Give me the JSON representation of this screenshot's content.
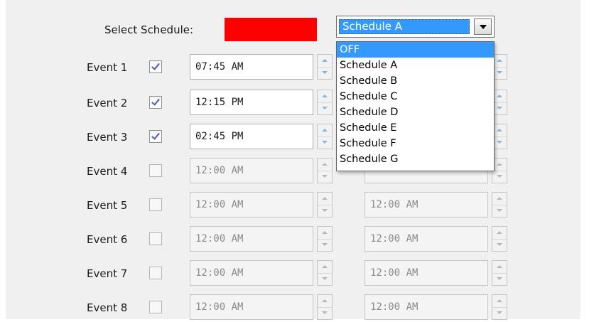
{
  "schedule": {
    "label": "Select Schedule:",
    "color": "#ff0000",
    "selected": "Schedule A",
    "options": [
      "OFF",
      "Schedule A",
      "Schedule B",
      "Schedule C",
      "Schedule D",
      "Schedule E",
      "Schedule F",
      "Schedule G"
    ],
    "highlighted_option": "OFF"
  },
  "events": [
    {
      "label": "Event 1",
      "checked": true,
      "start": "07:45 AM",
      "end": ""
    },
    {
      "label": "Event 2",
      "checked": true,
      "start": "12:15 PM",
      "end": ""
    },
    {
      "label": "Event 3",
      "checked": true,
      "start": "02:45 PM",
      "end": ""
    },
    {
      "label": "Event 4",
      "checked": false,
      "start": "12:00 AM",
      "end": ""
    },
    {
      "label": "Event 5",
      "checked": false,
      "start": "12:00 AM",
      "end": "12:00 AM"
    },
    {
      "label": "Event 6",
      "checked": false,
      "start": "12:00 AM",
      "end": "12:00 AM"
    },
    {
      "label": "Event 7",
      "checked": false,
      "start": "12:00 AM",
      "end": "12:00 AM"
    },
    {
      "label": "Event 8",
      "checked": false,
      "start": "12:00 AM",
      "end": "12:00 AM"
    }
  ],
  "icons": {
    "combo_arrow": "chevron-down-icon",
    "spin_up": "spin-up-icon",
    "spin_down": "spin-down-icon",
    "check": "checkmark-icon"
  }
}
